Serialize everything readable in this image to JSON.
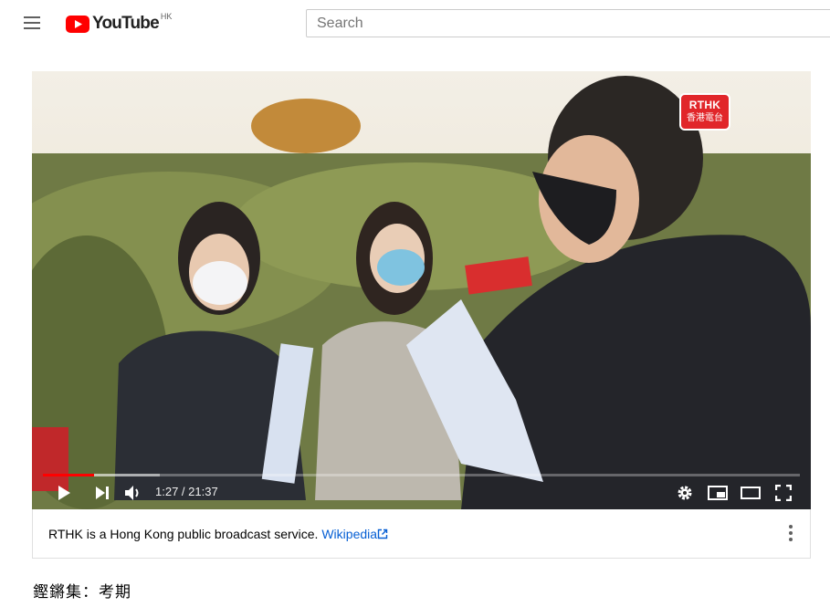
{
  "header": {
    "logo_text": "YouTube",
    "country_code": "HK",
    "search_placeholder": "Search"
  },
  "player": {
    "watermark_top": "RTHK",
    "watermark_bottom": "香港電台",
    "current_time": "1:27",
    "duration": "21:37",
    "time_display": "1:27 / 21:37",
    "progress_fraction": 0.067,
    "buffered_fraction": 0.154,
    "progress_color": "#ff0000"
  },
  "info_panel": {
    "text": "RTHK is a Hong Kong public broadcast service.",
    "link_text": "Wikipedia"
  },
  "video": {
    "title": "鏗鏘集：考期"
  },
  "icons": [
    "menu-icon",
    "youtube-logo-icon",
    "play-icon",
    "next-icon",
    "volume-icon",
    "settings-icon",
    "miniplayer-icon",
    "theater-mode-icon",
    "fullscreen-icon",
    "external-link-icon",
    "more-vert-icon"
  ]
}
